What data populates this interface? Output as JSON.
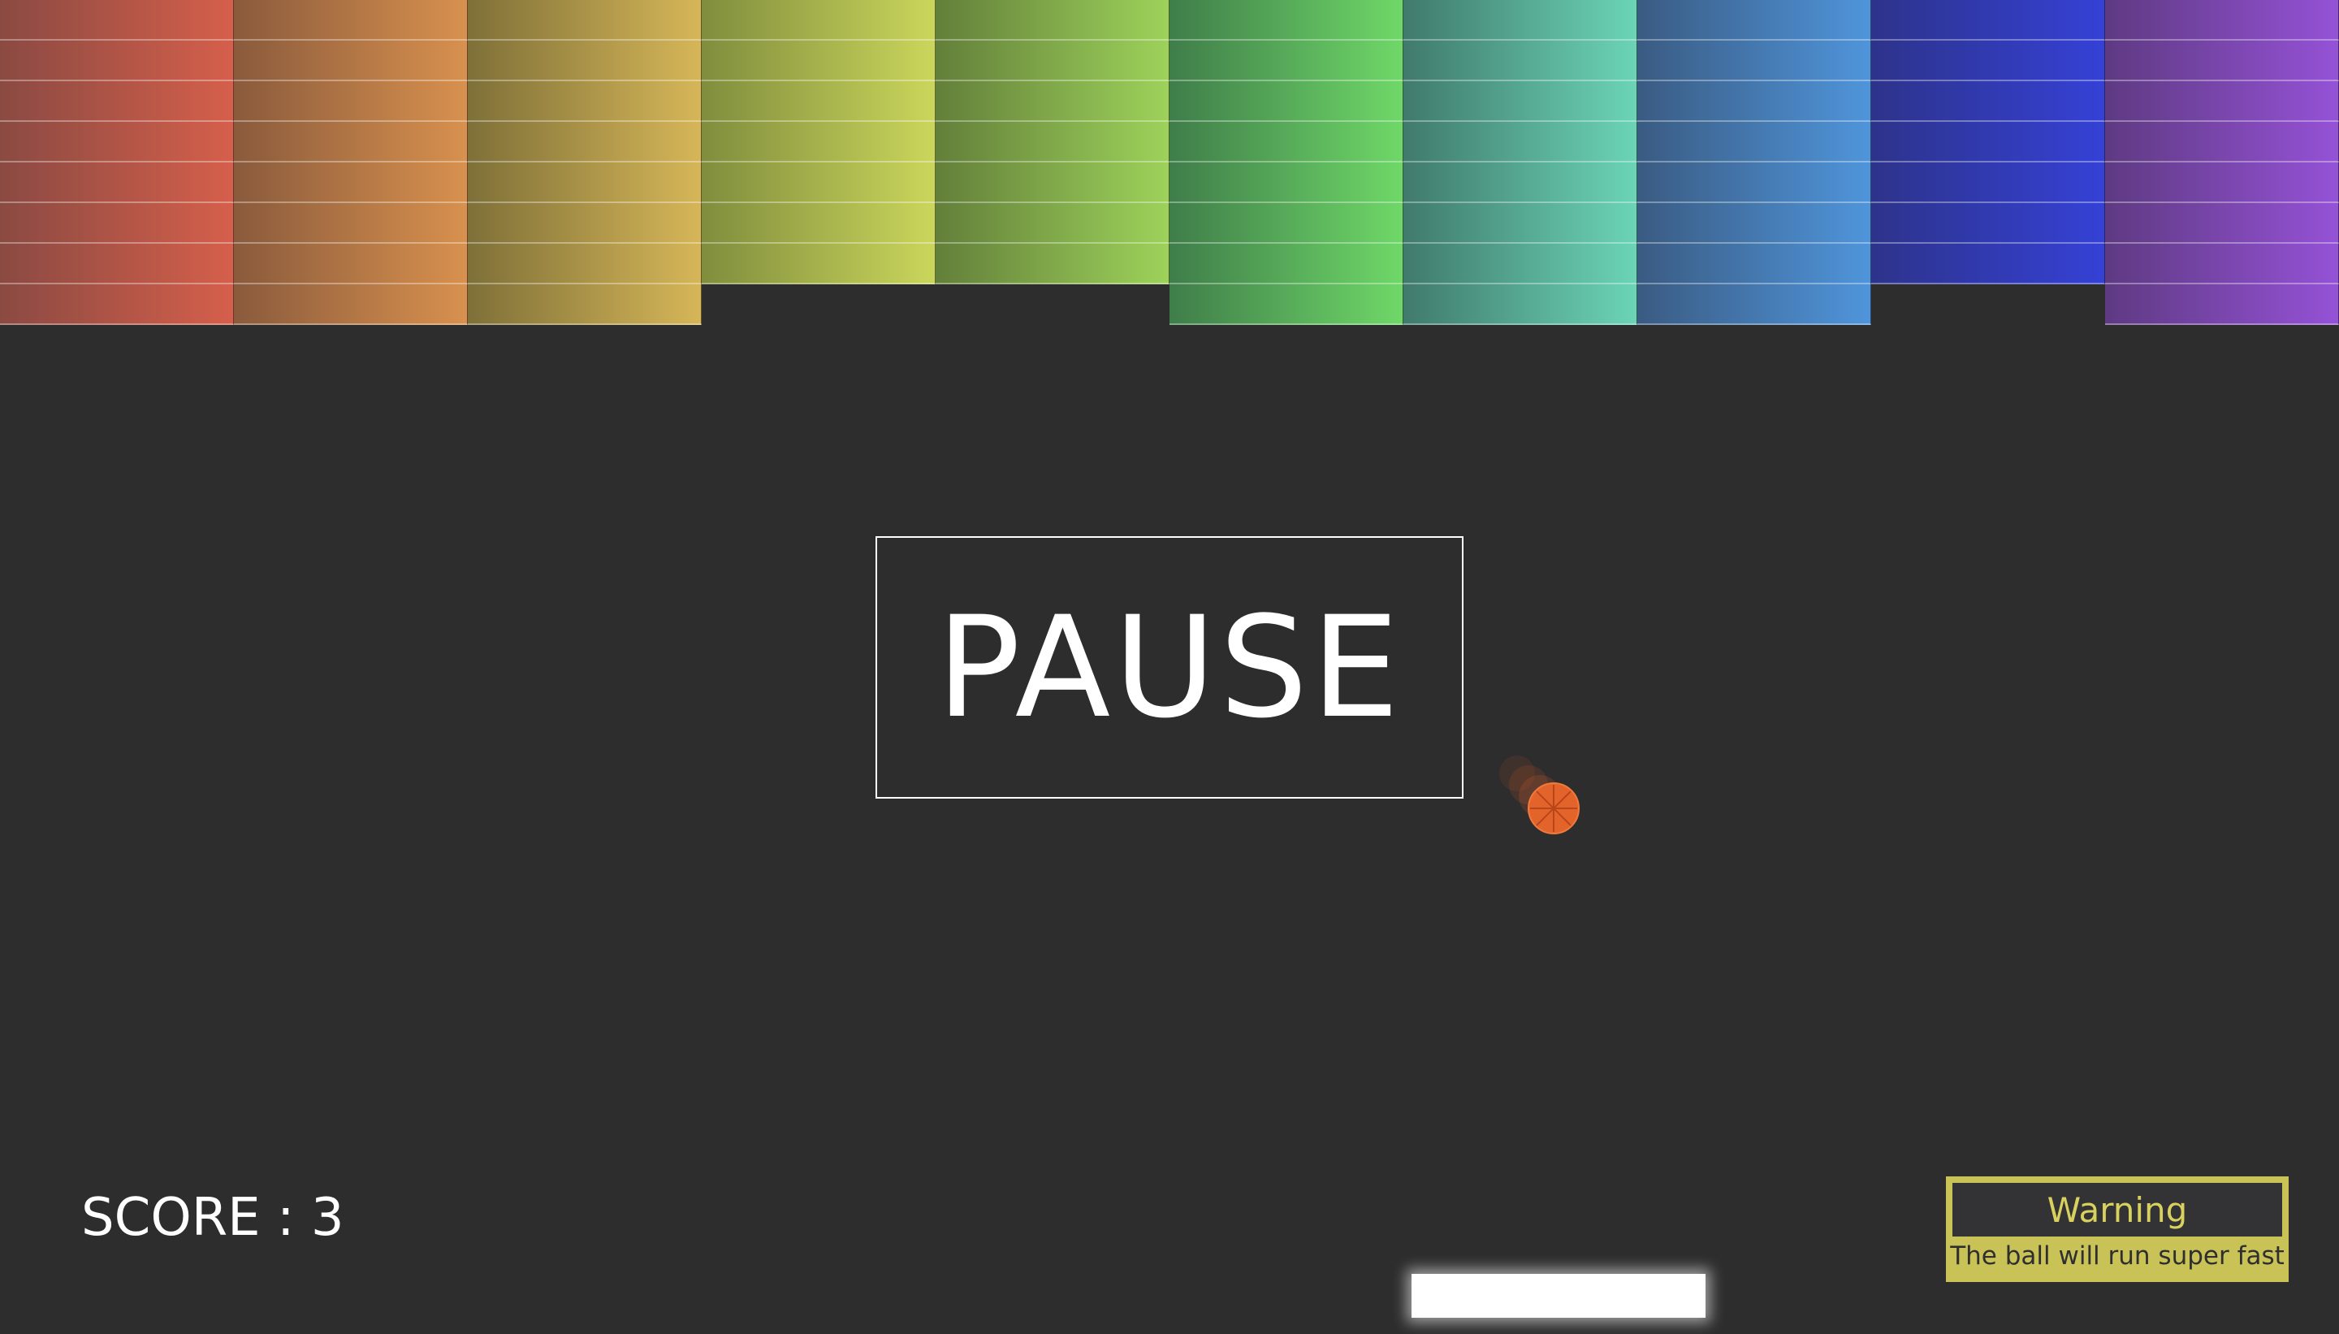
{
  "pause": {
    "label": "PAUSE"
  },
  "score": {
    "text": "SCORE : 3",
    "value": 3
  },
  "warning": {
    "title": "Warning",
    "message": "The ball will run super fast"
  },
  "bricks": {
    "rows_total": 8,
    "columns": [
      {
        "color_dark": "#8a4a42",
        "color_light": "#d55f4b",
        "rows": 8
      },
      {
        "color_dark": "#8a5a3c",
        "color_light": "#d8914e",
        "rows": 8
      },
      {
        "color_dark": "#7e7038",
        "color_light": "#d6b658",
        "rows": 8
      },
      {
        "color_dark": "#808d3d",
        "color_light": "#cad65b",
        "rows": 7
      },
      {
        "color_dark": "#637f3a",
        "color_light": "#9dd25a",
        "rows": 7
      },
      {
        "color_dark": "#3f7d4a",
        "color_light": "#6fd868",
        "rows": 8
      },
      {
        "color_dark": "#407a6c",
        "color_light": "#6bd4b7",
        "rows": 8
      },
      {
        "color_dark": "#3a5b82",
        "color_light": "#4f95db",
        "rows": 8
      },
      {
        "color_dark": "#2d338a",
        "color_light": "#3541d6",
        "rows": 7
      },
      {
        "color_dark": "#5e3a82",
        "color_light": "#9552d6",
        "rows": 8
      }
    ]
  },
  "colors": {
    "background": "#2d2d2d",
    "ball": "#e3642a",
    "paddle": "#ffffff",
    "warning_border": "#c9c357"
  }
}
